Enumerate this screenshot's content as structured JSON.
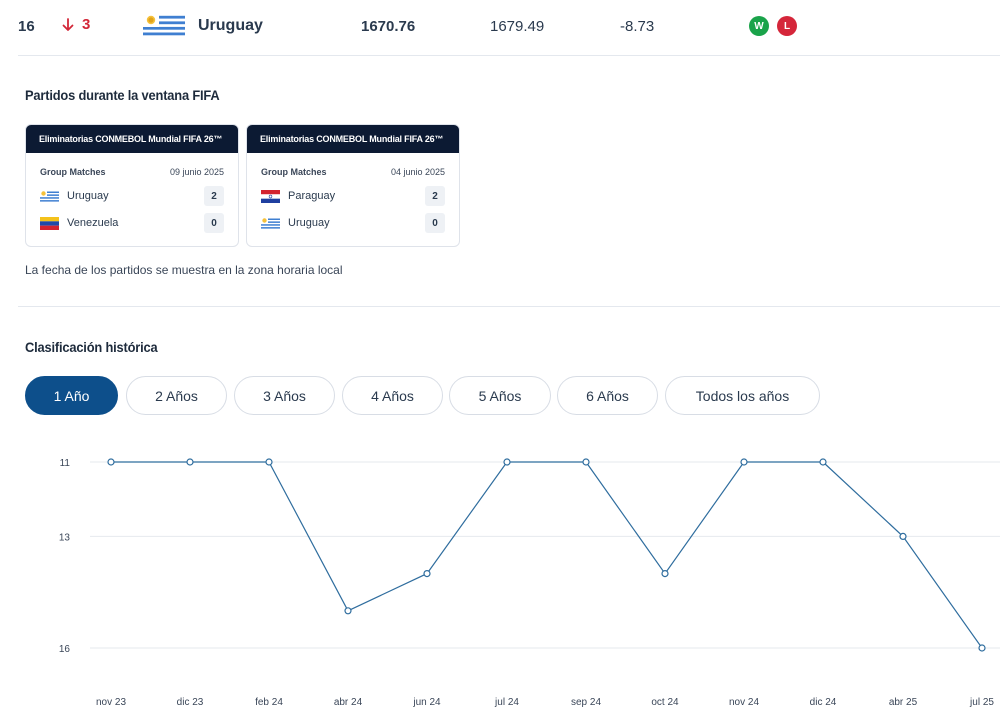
{
  "ranking_row": {
    "rank": "16",
    "rank_change": "3",
    "country": "Uruguay",
    "total_points": "1670.76",
    "previous_points": "1679.49",
    "points_diff": "-8.73",
    "form": [
      "W",
      "L"
    ],
    "colors": {
      "down": "#d32738",
      "win": "#1aa34a",
      "loss": "#d5263a"
    }
  },
  "window_matches": {
    "title": "Partidos durante la ventana FIFA",
    "cards": [
      {
        "competition": "Eliminatorias CONMEBOL Mundial FIFA 26™",
        "stage": "Group Matches",
        "date": "09 junio 2025",
        "teams": [
          {
            "name": "Uruguay",
            "flag": "uruguay-flag",
            "score": "2"
          },
          {
            "name": "Venezuela",
            "flag": "venezuela-flag",
            "score": "0"
          }
        ]
      },
      {
        "competition": "Eliminatorias CONMEBOL Mundial FIFA 26™",
        "stage": "Group Matches",
        "date": "04 junio 2025",
        "teams": [
          {
            "name": "Paraguay",
            "flag": "paraguay-flag",
            "score": "2"
          },
          {
            "name": "Uruguay",
            "flag": "uruguay-flag",
            "score": "0"
          }
        ]
      }
    ],
    "timezone_note": "La fecha de los partidos se muestra en la zona horaria local"
  },
  "history": {
    "title": "Clasificación histórica",
    "periods": [
      "1 Año",
      "2 Años",
      "3 Años",
      "4 Años",
      "5 Años",
      "6 Años",
      "Todos los años"
    ],
    "active_period": "1 Año",
    "accent": "#0d4f8b"
  },
  "chart_data": {
    "type": "line",
    "x": [
      "nov 23",
      "dic 23",
      "feb 24",
      "abr 24",
      "jun 24",
      "jul 24",
      "sep 24",
      "oct 24",
      "nov 24",
      "dic 24",
      "abr 25",
      "jul 25"
    ],
    "series": [
      {
        "values": [
          11,
          11,
          11,
          15,
          14,
          11,
          11,
          14,
          11,
          11,
          13,
          16
        ]
      }
    ],
    "yticks": [
      11,
      13,
      16
    ],
    "ylim": [
      11,
      16
    ],
    "y_inverted": true,
    "grid": true,
    "line_color": "#2f6d9e"
  }
}
